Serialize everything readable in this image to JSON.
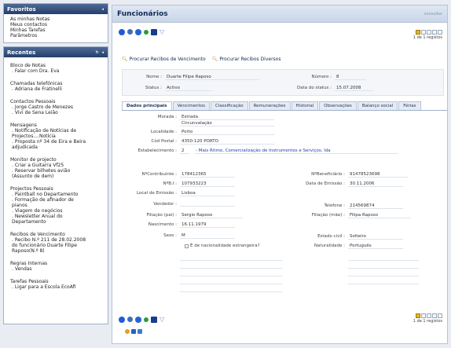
{
  "favorites": {
    "title": "Favoritos",
    "items": [
      "As minhas Notas",
      "Meus contactos",
      "Minhas Tarefas",
      "Parâmetros"
    ]
  },
  "recent": {
    "title": "Recentes",
    "groups": [
      {
        "title": "Bloco de Notas",
        "items": [
          ". Falar com Dra. Eva"
        ]
      },
      {
        "title": "Chamadas telefónicas",
        "items": [
          ". Adriana de Fratinelli"
        ]
      },
      {
        "title": "Contactos Pessoais",
        "items": [
          ". Jorge Castro de Menezes",
          ". Vivi de Sena Leião"
        ]
      },
      {
        "title": "Mensagens",
        "items": [
          ". Notificação de Notícias de",
          "Projectos....Notícia",
          ". Proposta nº 34 de Eira e Beira",
          "adjudicada"
        ]
      },
      {
        "title": "Monitor de projecto",
        "items": [
          ". Criar a Guitarra Vf25",
          ". Reservar bilhetes avião",
          "(Assunto de dem)"
        ]
      },
      {
        "title": "Projectos Pessoais",
        "items": [
          ". Paintball no Departamento",
          ". Formação de afinador de",
          "pianos",
          ". Viagem de negócios",
          ". Newsletter Anual do",
          "Departamento"
        ]
      },
      {
        "title": "Recibos de Vencimento",
        "items": [
          ". Recibo N.º 211 de 28.02.2008",
          "do funcionário Duarte Filipe",
          "Raposo(N.º 8)"
        ]
      },
      {
        "title": "Regras Internas",
        "items": [
          ". Vendas"
        ]
      },
      {
        "title": "Tarefas Pessoais",
        "items": [
          ". Ligar para a Escola EcoAfi"
        ]
      }
    ]
  },
  "main": {
    "title": "Funcionários",
    "header_right": "consultar",
    "pager_text": "1 de 1 registos",
    "links": [
      "Procurar Recibos de Vencimento",
      "Procurar Recibos Diversos"
    ],
    "info": {
      "nome_label": "Nome :",
      "nome_value": "Duarte Filipe Raposo",
      "status_label": "Status :",
      "status_value": "Activo",
      "numero_label": "Número :",
      "numero_value": "8",
      "data_status_label": "Data do status :",
      "data_status_value": "15.07.2008"
    },
    "tabs": [
      "Dados principais",
      "Vencimentos",
      "Classificação",
      "Remunerações",
      "Historial",
      "Observações",
      "Balanço social",
      "Férias"
    ],
    "fields": {
      "morada_label": "Morada :",
      "morada_value1": "Estrada",
      "morada_value2": "Circunvalação",
      "localidade_label": "Localidade :",
      "localidade_value": "Porto",
      "cod_postal_label": "Cód Postal :",
      "cod_postal_value": "4350-120 PORTO",
      "estab_label": "Estabelecimento :",
      "estab_num": "2",
      "estab_value": "- Mais Ritmo, Comercialização de Instrumentos e Serviços, lda",
      "contrib_label": "NºContribuinte :",
      "contrib_value": "178412365",
      "bi_label": "NºB.I :",
      "bi_value": "107933223",
      "local_emissao_label": "Local de Emissão :",
      "local_emissao_value": "Lisboa",
      "vendedor_label": "Vendedor :",
      "filiacao_pai_label": "Filiação (pai) :",
      "filiacao_pai_value": "Sergio Raposo",
      "nascimento_label": "Nascimento :",
      "nascimento_value": "16.11.1979",
      "sexo_label": "Sexo :",
      "sexo_value": "M",
      "estrangeira_label": "É de nacionalidade estrangeira?",
      "beneficiario_label": "NºBeneficiário :",
      "beneficiario_value": "91478523698",
      "data_emissao_label": "Data de Emissão :",
      "data_emissao_value": "30.11.2006",
      "telefone_label": "Telefone :",
      "telefone_value": "214569874",
      "filiacao_mae_label": "Filiação (mãe) :",
      "filiacao_mae_value": "Filipa Raposo",
      "estado_civil_label": "Estado civil :",
      "estado_civil_value": "Solteiro",
      "naturalidade_label": "Naturalidade :",
      "naturalidade_value": "Português"
    }
  }
}
